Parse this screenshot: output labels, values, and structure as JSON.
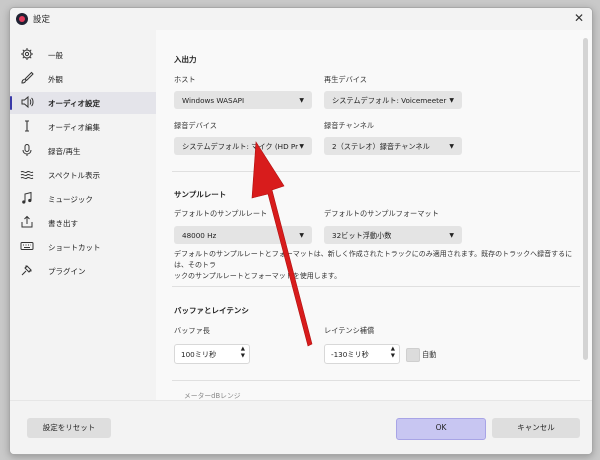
{
  "window": {
    "title": "設定"
  },
  "sidebar": {
    "items": [
      {
        "label": "一般"
      },
      {
        "label": "外観"
      },
      {
        "label": "オーディオ設定"
      },
      {
        "label": "オーディオ編集"
      },
      {
        "label": "録音/再生"
      },
      {
        "label": "スペクトル表示"
      },
      {
        "label": "ミュージック"
      },
      {
        "label": "書き出す"
      },
      {
        "label": "ショートカット"
      },
      {
        "label": "プラグイン"
      }
    ]
  },
  "io": {
    "heading": "入出力",
    "host_label": "ホスト",
    "host_value": "Windows WASAPI",
    "playback_label": "再生デバイス",
    "playback_value": "システムデフォルト: Voicemeeter ...",
    "record_label": "録音デバイス",
    "record_value": "システムデフォルト: マイク (HD Pr...",
    "channel_label": "録音チャンネル",
    "channel_value": "2（ステレオ）録音チャンネル"
  },
  "sample": {
    "heading": "サンプルレート",
    "rate_label": "デフォルトのサンプルレート",
    "rate_value": "48000 Hz",
    "format_label": "デフォルトのサンプルフォーマット",
    "format_value": "32ビット浮動小数",
    "note_line1": "デフォルトのサンプルレートとフォーマットは、新しく作成されたトラックにのみ適用されます。既存のトラックへ録音するには、そのトラ",
    "note_line2": "ックのサンプルレートとフォーマットを使用します。"
  },
  "buffer": {
    "heading": "バッファとレイテンシ",
    "length_label": "バッファ長",
    "length_value": "100ミリ秒",
    "latency_label": "レイテンシ補償",
    "latency_value": "-130ミリ秒",
    "auto_label": "自動"
  },
  "meter": {
    "label": "メーターdBレンジ"
  },
  "footer": {
    "reset": "設定をリセット",
    "ok": "OK",
    "cancel": "キャンセル"
  },
  "colors": {
    "accent": "#3a3aa8",
    "arrow": "#dd2222",
    "ok_button": "#c8c6f2"
  }
}
